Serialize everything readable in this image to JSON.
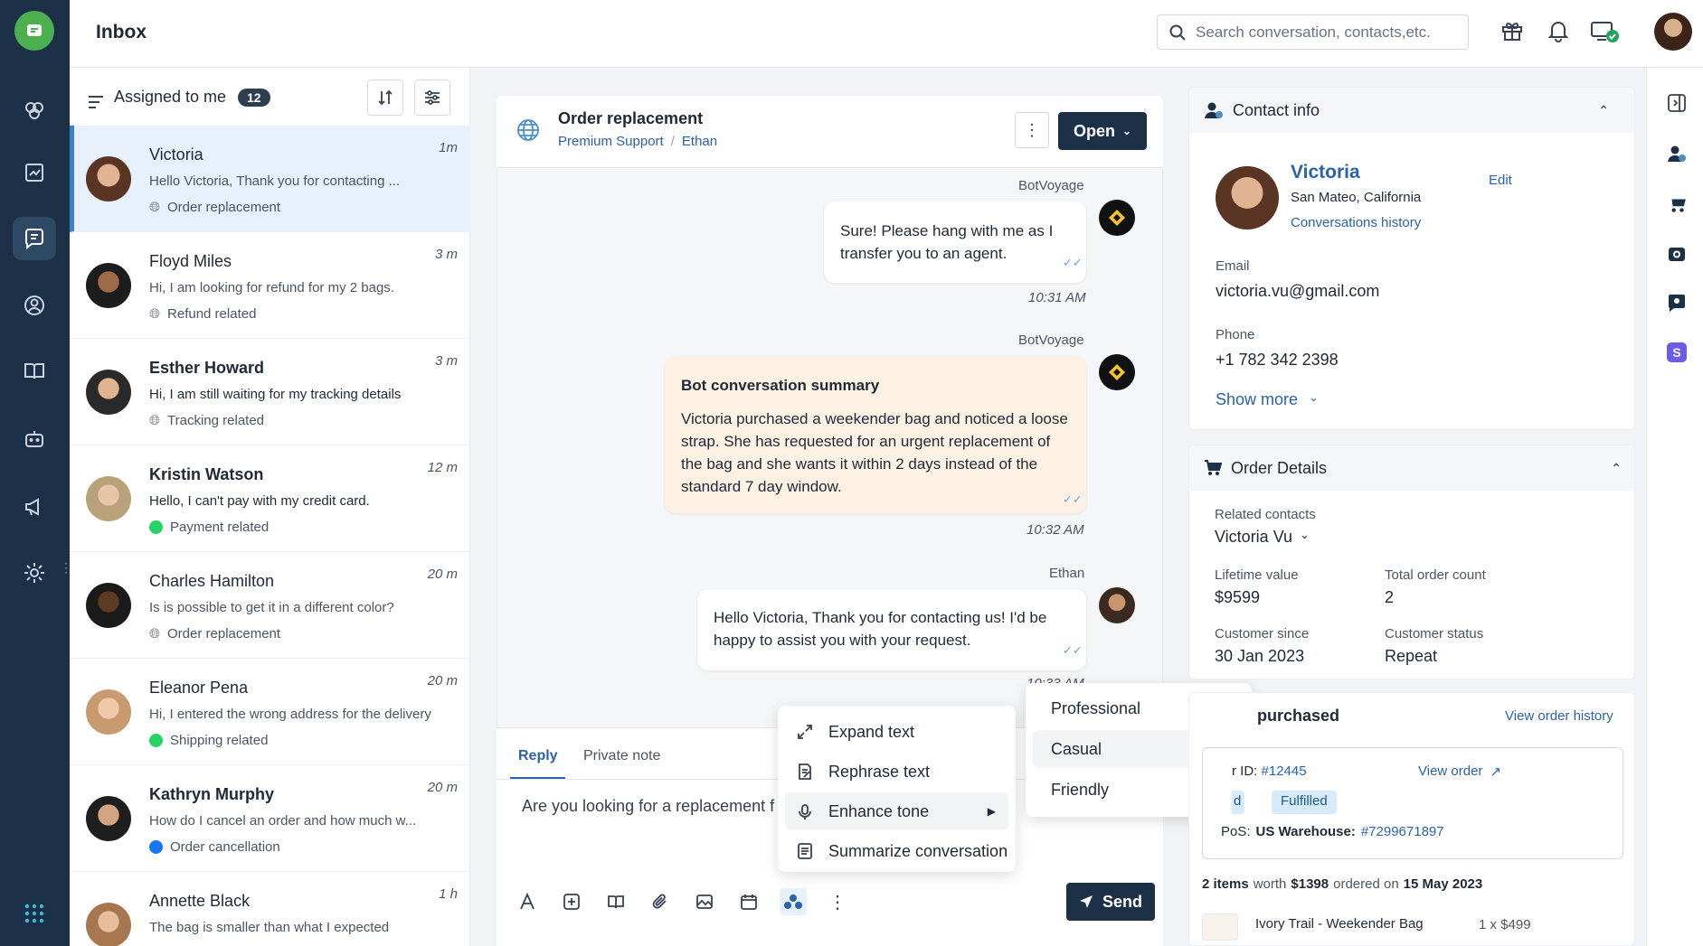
{
  "header": {
    "title": "Inbox",
    "search_placeholder": "Search conversation, contacts,etc."
  },
  "list": {
    "filter_label": "Assigned to me",
    "count": "12",
    "items": [
      {
        "name": "Victoria",
        "time": "1m",
        "preview": "Hello Victoria, Thank you for contacting ...",
        "tag": "Order replacement",
        "channel": "web"
      },
      {
        "name": "Floyd Miles",
        "time": "3 m",
        "preview": "Hi, I am looking for refund for my 2 bags.",
        "tag": "Refund related",
        "channel": "web"
      },
      {
        "name": "Esther Howard",
        "time": "3 m",
        "preview": "Hi, I am still waiting for my tracking details",
        "tag": "Tracking related",
        "channel": "web"
      },
      {
        "name": "Kristin Watson",
        "time": "12 m",
        "preview": "Hello, I can't pay with my credit card.",
        "tag": "Payment related",
        "channel": "whatsapp"
      },
      {
        "name": "Charles Hamilton",
        "time": "20 m",
        "preview": "Is is possible to get it in a different color?",
        "tag": "Order replacement",
        "channel": "web"
      },
      {
        "name": "Eleanor Pena",
        "time": "20 m",
        "preview": "Hi, I entered the wrong address for the delivery",
        "tag": "Shipping related",
        "channel": "whatsapp"
      },
      {
        "name": "Kathryn Murphy",
        "time": "20 m",
        "preview": "How do I cancel an order and how much w...",
        "tag": "Order cancellation",
        "channel": "facebook"
      },
      {
        "name": "Annette Black",
        "time": "1 h",
        "preview": "The bag is smaller than what I expected",
        "tag": "",
        "channel": "web"
      }
    ]
  },
  "chat": {
    "title": "Order replacement",
    "breadcrumb_team": "Premium Support",
    "breadcrumb_sep": "/",
    "breadcrumb_agent": "Ethan",
    "status_button": "Open",
    "messages": [
      {
        "sender": "BotVoyage",
        "text": "Sure! Please hang with me as I transfer you to an agent.",
        "time": "10:31 AM"
      },
      {
        "sender": "BotVoyage",
        "title": "Bot conversation summary",
        "text": "Victoria purchased a weekender bag and noticed a loose strap. She has requested for an urgent replacement of the bag and she wants it within 2 days instead of the standard 7 day window.",
        "time": "10:32 AM"
      },
      {
        "sender": "Ethan",
        "text": "Hello Victoria, Thank you for contacting us! I'd be happy to assist you with your request.",
        "time": "10:33 AM"
      }
    ]
  },
  "composer": {
    "tab_reply": "Reply",
    "tab_note": "Private note",
    "draft": "Are you looking for a replacement f",
    "send_label": "Send"
  },
  "ai_menu": {
    "items": [
      "Expand text",
      "Rephrase text",
      "Enhance tone",
      "Summarize conversation"
    ],
    "tones": [
      "Professional",
      "Casual",
      "Friendly"
    ]
  },
  "contact": {
    "header": "Contact info",
    "name": "Victoria",
    "location": "San Mateo, California",
    "history_link": "Conversations history",
    "edit": "Edit",
    "email_label": "Email",
    "email": "victoria.vu@gmail.com",
    "phone_label": "Phone",
    "phone": "+1 782 342 2398",
    "show_more": "Show more"
  },
  "order": {
    "header": "Order Details",
    "related_label": "Related contacts",
    "related_value": "Victoria Vu",
    "lifetime_label": "Lifetime value",
    "lifetime_value": "$9599",
    "count_label": "Total order count",
    "count_value": "2",
    "since_label": "Customer since",
    "since_value": "30 Jan 2023",
    "status_label": "Customer status",
    "status_value": "Repeat"
  },
  "purchased": {
    "header": "purchased",
    "history_link": "View order history",
    "order_id_label": "r ID:",
    "order_id": "#12445",
    "view_order": "View order",
    "badge_left": "d",
    "badge_fulfilled": "Fulfilled",
    "pos_label": "PoS:",
    "pos_value": "US Warehouse:",
    "pos_id": "#7299671897",
    "summary_count": "2 items",
    "summary_worth": "worth",
    "summary_amount": "$1398",
    "summary_ordered": "ordered on",
    "summary_date": "15 May 2023",
    "item_name": "Ivory Trail - Weekender Bag",
    "item_qty": "1 x $499"
  },
  "colors": {
    "nav": "#1c3148",
    "accent": "#1c3148",
    "link": "#2b62a8",
    "summary_bg": "#fdf1e3",
    "selected_row": "#e8f1fb"
  }
}
